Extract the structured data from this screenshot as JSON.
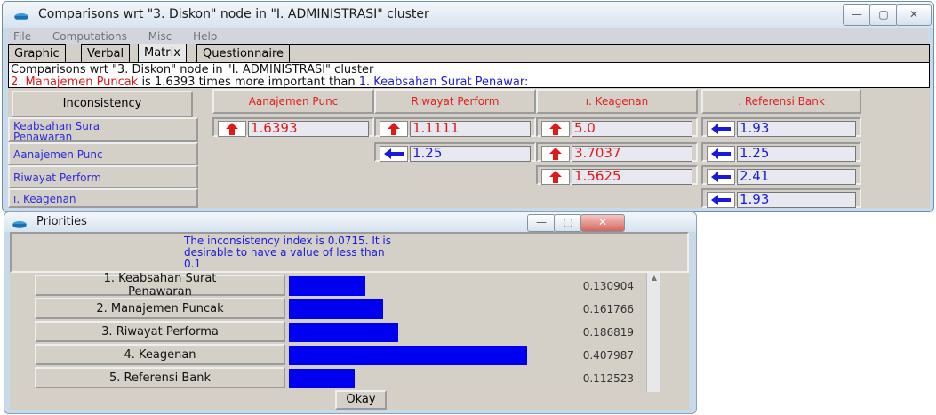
{
  "comparisons": {
    "title": "Comparisons wrt \"3. Diskon\" node in \"I. ADMINISTRASI\" cluster",
    "menu": [
      "File",
      "Computations",
      "Misc",
      "Help"
    ],
    "tabs": [
      "Graphic",
      "Verbal",
      "Matrix",
      "Questionnaire"
    ],
    "active_tab": "Matrix",
    "header_line1": "Comparisons wrt \"3. Diskon\" node in \"I. ADMINISTRASI\" cluster",
    "header_line2": {
      "subject": "2. Manajemen Puncak",
      "middle": " is 1.6393 times more important than ",
      "object": "1. Keabsahan Surat Penawar:"
    },
    "inconsistency_button": "Inconsistency",
    "columns": [
      "Aanajemen Punc",
      "Riwayat Perform",
      "ı. Keagenan",
      ". Referensi Bank"
    ],
    "rows": [
      {
        "label": "Keabsahan Sura\nPenawaran",
        "cells": [
          {
            "dir": "up",
            "value": "1.6393"
          },
          {
            "dir": "up",
            "value": "1.1111"
          },
          {
            "dir": "up",
            "value": "5.0"
          },
          {
            "dir": "left",
            "value": "1.93"
          }
        ]
      },
      {
        "label": "Aanajemen Punc",
        "cells": [
          null,
          {
            "dir": "left",
            "value": "1.25"
          },
          {
            "dir": "up",
            "value": "3.7037"
          },
          {
            "dir": "left",
            "value": "1.25"
          }
        ]
      },
      {
        "label": "Riwayat Perform",
        "cells": [
          null,
          null,
          {
            "dir": "up",
            "value": "1.5625"
          },
          {
            "dir": "left",
            "value": "2.41"
          }
        ]
      },
      {
        "label": "ı. Keagenan",
        "cells": [
          null,
          null,
          null,
          {
            "dir": "left",
            "value": "1.93"
          }
        ]
      }
    ]
  },
  "priorities": {
    "title": "Priorities",
    "message": "The inconsistency index is 0.0715.  It is\ndesirable to have a value of less than\n0.1",
    "items": [
      {
        "label": "1. Keabsahan Surat\nPenawaran",
        "value": "0.130904",
        "fraction": 0.130904
      },
      {
        "label": "2. Manajemen Puncak",
        "value": "0.161766",
        "fraction": 0.161766
      },
      {
        "label": "3. Riwayat Performa",
        "value": "0.186819",
        "fraction": 0.186819
      },
      {
        "label": "4. Keagenan",
        "value": "0.407987",
        "fraction": 0.407987
      },
      {
        "label": "5. Referensi Bank",
        "value": "0.112523",
        "fraction": 0.112523
      }
    ],
    "okay_label": "Okay"
  },
  "colors": {
    "bar": "#0000f0",
    "arrow_red": "#e01a1a",
    "arrow_blue": "#1a1ad8"
  }
}
